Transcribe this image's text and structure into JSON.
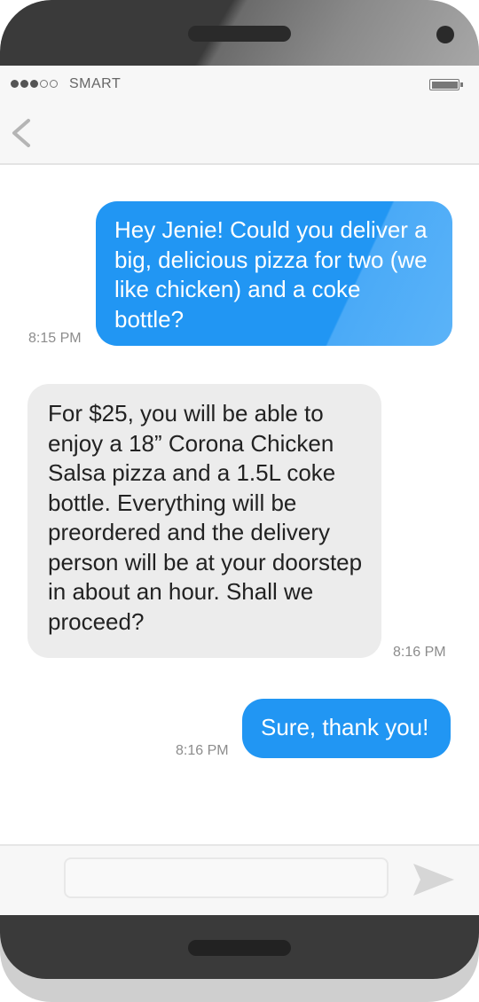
{
  "status_bar": {
    "carrier": "SMART",
    "signal_strength": 3,
    "signal_total": 5
  },
  "messages": [
    {
      "direction": "outgoing",
      "text": "Hey Jenie! Could you deliver a big, delicious pizza for two (we like chicken) and a coke bottle?",
      "time": "8:15 PM"
    },
    {
      "direction": "incoming",
      "text": "For $25, you will be able to enjoy a 18” Corona Chicken Salsa pizza and a 1.5L coke bottle. Everything will be preordered and the delivery person will be at your doorstep in about an hour. Shall we proceed?",
      "time": "8:16 PM"
    },
    {
      "direction": "outgoing",
      "text": "Sure, thank you!",
      "time": "8:16 PM"
    }
  ],
  "composer": {
    "placeholder": ""
  },
  "colors": {
    "outgoing_bubble": "#2196f3",
    "incoming_bubble": "#ececec",
    "bezel": "#3a3a3a"
  },
  "icons": {
    "back": "chevron-left-icon",
    "send": "send-arrow-icon"
  }
}
